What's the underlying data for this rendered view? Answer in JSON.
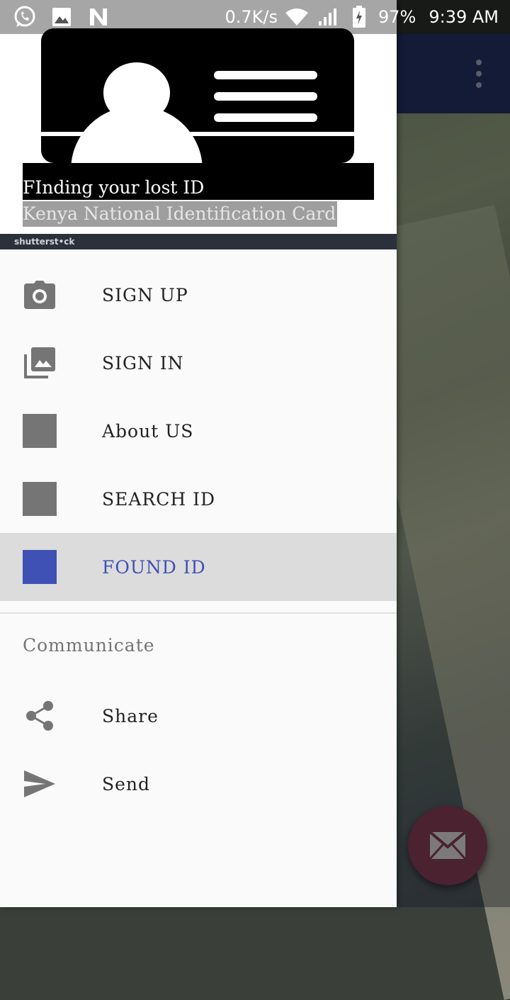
{
  "status_bar": {
    "net_speed": "0.7K/s",
    "battery": "97%",
    "time": "9:39 AM",
    "icons": [
      "whatsapp-icon",
      "image-icon",
      "n-app-icon",
      "wifi-icon",
      "signal-icon",
      "battery-icon"
    ]
  },
  "drawer": {
    "header": {
      "title": "FInding your lost ID",
      "subtitle": "Kenya National Identification Card",
      "watermark": "shutterst•ck"
    },
    "items": [
      {
        "label": "SIGN UP",
        "icon": "camera-icon"
      },
      {
        "label": "SIGN IN",
        "icon": "gallery-icon"
      },
      {
        "label": "About US",
        "icon": "square-icon"
      },
      {
        "label": "SEARCH ID",
        "icon": "square-icon"
      },
      {
        "label": "FOUND ID",
        "icon": "square-icon",
        "selected": true
      }
    ],
    "section_title": "Communicate",
    "section_items": [
      {
        "label": "Share",
        "icon": "share-icon"
      },
      {
        "label": "Send",
        "icon": "send-icon"
      }
    ]
  },
  "colors": {
    "primary": "#1f2a55",
    "accent": "#3f51b5",
    "fab": "#4a2230",
    "selected_bg": "#dcdcdc"
  },
  "fab": {
    "icon": "email-icon"
  }
}
